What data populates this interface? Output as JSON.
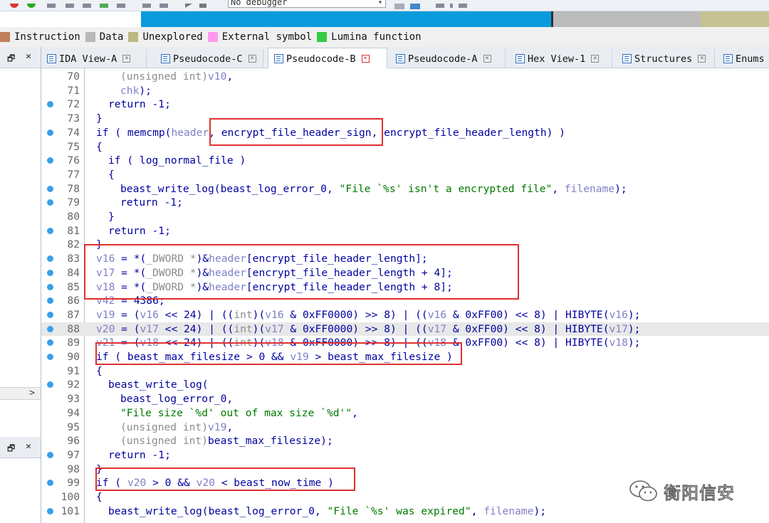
{
  "toolbar": {
    "debugger_select": "No debugger"
  },
  "legend": [
    {
      "label": "Instruction",
      "color": "#c0805a"
    },
    {
      "label": "Data",
      "color": "#b8b8b8"
    },
    {
      "label": "Unexplored",
      "color": "#bcb882"
    },
    {
      "label": "External symbol",
      "color": "#ff99ee"
    },
    {
      "label": "Lumina function",
      "color": "#33cc44"
    }
  ],
  "tabs": [
    {
      "label": "IDA View-A",
      "icon": "ida-view-icon",
      "active": false
    },
    {
      "label": "Pseudocode-C",
      "icon": "pseudocode-icon",
      "active": false
    },
    {
      "label": "Pseudocode-B",
      "icon": "pseudocode-icon",
      "active": true
    },
    {
      "label": "Pseudocode-A",
      "icon": "pseudocode-icon",
      "active": false
    },
    {
      "label": "Hex View-1",
      "icon": "hex-view-icon",
      "active": false
    },
    {
      "label": "Structures",
      "icon": "structures-icon",
      "active": false
    },
    {
      "label": "Enums",
      "icon": "enums-icon",
      "active": false
    }
  ],
  "left_panel": {
    "pin_glyph": "🗗",
    "close_glyph": "✕",
    "scroll_glyph": ">"
  },
  "code_lines": [
    {
      "n": "70",
      "dot": false,
      "hl": false,
      "t": [
        [
          "m",
          "(unsigned int)"
        ],
        [
          "v",
          "v10"
        ],
        [
          "p",
          ",\n"
        ]
      ]
    },
    {
      "n": "71",
      "dot": false,
      "hl": false,
      "t": [
        [
          "v",
          "chk"
        ],
        [
          "p",
          ");"
        ]
      ]
    },
    {
      "n": "72",
      "dot": true,
      "hl": false,
      "t": [
        [
          "p",
          "return -1;"
        ]
      ]
    },
    {
      "n": "73",
      "dot": false,
      "hl": false,
      "t": [
        [
          "p",
          "}"
        ]
      ]
    },
    {
      "n": "74",
      "dot": true,
      "hl": false,
      "t": [
        [
          "p",
          "if ( memcmp("
        ],
        [
          "v",
          "header"
        ],
        [
          "p",
          ", encrypt_file_header_sign, encrypt_file_header_length) )"
        ]
      ]
    },
    {
      "n": "75",
      "dot": false,
      "hl": false,
      "t": [
        [
          "p",
          "{"
        ]
      ]
    },
    {
      "n": "76",
      "dot": true,
      "hl": false,
      "t": [
        [
          "p",
          "if ( log_normal_file )"
        ]
      ]
    },
    {
      "n": "77",
      "dot": false,
      "hl": false,
      "t": [
        [
          "p",
          "{"
        ]
      ]
    },
    {
      "n": "78",
      "dot": true,
      "hl": false,
      "t": [
        [
          "p",
          "beast_write_log(beast_log_error_0, "
        ],
        [
          "s",
          "\"File `%s' isn't a encrypted file\""
        ],
        [
          "p",
          ", "
        ],
        [
          "v",
          "filename"
        ],
        [
          "p",
          ");"
        ]
      ]
    },
    {
      "n": "79",
      "dot": true,
      "hl": false,
      "t": [
        [
          "p",
          "return -1;"
        ]
      ]
    },
    {
      "n": "80",
      "dot": false,
      "hl": false,
      "t": [
        [
          "p",
          "}"
        ]
      ]
    },
    {
      "n": "81",
      "dot": true,
      "hl": false,
      "t": [
        [
          "p",
          "return -1;"
        ]
      ]
    },
    {
      "n": "82",
      "dot": false,
      "hl": false,
      "t": [
        [
          "p",
          "}"
        ]
      ]
    },
    {
      "n": "83",
      "dot": true,
      "hl": false,
      "t": [
        [
          "v",
          "v16"
        ],
        [
          "p",
          " = *("
        ],
        [
          "m",
          "_DWORD *"
        ],
        [
          "p",
          ")&"
        ],
        [
          "v",
          "header"
        ],
        [
          "p",
          "[encrypt_file_header_length];"
        ]
      ]
    },
    {
      "n": "84",
      "dot": true,
      "hl": false,
      "t": [
        [
          "v",
          "v17"
        ],
        [
          "p",
          " = *("
        ],
        [
          "m",
          "_DWORD *"
        ],
        [
          "p",
          ")&"
        ],
        [
          "v",
          "header"
        ],
        [
          "p",
          "[encrypt_file_header_length + 4];"
        ]
      ]
    },
    {
      "n": "85",
      "dot": true,
      "hl": false,
      "t": [
        [
          "v",
          "v18"
        ],
        [
          "p",
          " = *("
        ],
        [
          "m",
          "_DWORD *"
        ],
        [
          "p",
          ")&"
        ],
        [
          "v",
          "header"
        ],
        [
          "p",
          "[encrypt_file_header_length + 8];"
        ]
      ]
    },
    {
      "n": "86",
      "dot": true,
      "hl": false,
      "t": [
        [
          "v",
          "v42"
        ],
        [
          "p",
          " = 4386;"
        ]
      ]
    },
    {
      "n": "87",
      "dot": true,
      "hl": false,
      "t": [
        [
          "v",
          "v19"
        ],
        [
          "p",
          " = ("
        ],
        [
          "v",
          "v16"
        ],
        [
          "p",
          " << 24) | (("
        ],
        [
          "m",
          "int"
        ],
        [
          "p",
          ")("
        ],
        [
          "v",
          "v16"
        ],
        [
          "p",
          " & 0xFF0000) >> 8) | (("
        ],
        [
          "v",
          "v16"
        ],
        [
          "p",
          " & 0xFF00) << 8) | HIBYTE("
        ],
        [
          "v",
          "v16"
        ],
        [
          "p",
          ");"
        ]
      ]
    },
    {
      "n": "88",
      "dot": true,
      "hl": true,
      "t": [
        [
          "v",
          "v20"
        ],
        [
          "p",
          " = ("
        ],
        [
          "v",
          "v17"
        ],
        [
          "p",
          " << 24) | (("
        ],
        [
          "m",
          "int"
        ],
        [
          "p",
          ")("
        ],
        [
          "v",
          "v17"
        ],
        [
          "p",
          " & 0xFF0000) >> 8) | (("
        ],
        [
          "v",
          "v17"
        ],
        [
          "p",
          " & 0xFF00) << 8) | HIBYTE("
        ],
        [
          "v",
          "v17"
        ],
        [
          "p",
          ");"
        ]
      ]
    },
    {
      "n": "89",
      "dot": true,
      "hl": false,
      "t": [
        [
          "v",
          "v21"
        ],
        [
          "p",
          " = ("
        ],
        [
          "v",
          "v18"
        ],
        [
          "p",
          " << 24) | (("
        ],
        [
          "m",
          "int"
        ],
        [
          "p",
          ")("
        ],
        [
          "v",
          "v18"
        ],
        [
          "p",
          " & 0xFF0000) >> 8) | (("
        ],
        [
          "v",
          "v18"
        ],
        [
          "p",
          " & 0xFF00) << 8) | HIBYTE("
        ],
        [
          "v",
          "v18"
        ],
        [
          "p",
          ");"
        ]
      ]
    },
    {
      "n": "90",
      "dot": true,
      "hl": false,
      "t": [
        [
          "p",
          "if ( beast_max_filesize > 0 && "
        ],
        [
          "v",
          "v19"
        ],
        [
          "p",
          " > beast_max_filesize )"
        ]
      ]
    },
    {
      "n": "91",
      "dot": false,
      "hl": false,
      "t": [
        [
          "p",
          "{"
        ]
      ]
    },
    {
      "n": "92",
      "dot": true,
      "hl": false,
      "t": [
        [
          "p",
          "beast_write_log("
        ]
      ]
    },
    {
      "n": "93",
      "dot": false,
      "hl": false,
      "t": [
        [
          "p",
          "beast_log_error_0,"
        ]
      ]
    },
    {
      "n": "94",
      "dot": false,
      "hl": false,
      "t": [
        [
          "s",
          "\"File size `%d' out of max size `%d'\""
        ],
        [
          "p",
          ","
        ]
      ]
    },
    {
      "n": "95",
      "dot": false,
      "hl": false,
      "t": [
        [
          "m",
          "(unsigned int)"
        ],
        [
          "v",
          "v19"
        ],
        [
          "p",
          ","
        ]
      ]
    },
    {
      "n": "96",
      "dot": false,
      "hl": false,
      "t": [
        [
          "m",
          "(unsigned int)"
        ],
        [
          "p",
          "beast_max_filesize);"
        ]
      ]
    },
    {
      "n": "97",
      "dot": true,
      "hl": false,
      "t": [
        [
          "p",
          "return -1;"
        ]
      ]
    },
    {
      "n": "98",
      "dot": false,
      "hl": false,
      "t": [
        [
          "p",
          "}"
        ]
      ]
    },
    {
      "n": "99",
      "dot": true,
      "hl": false,
      "t": [
        [
          "p",
          "if ( "
        ],
        [
          "v",
          "v20"
        ],
        [
          "p",
          " > 0 && "
        ],
        [
          "v",
          "v20"
        ],
        [
          "p",
          " < beast_now_time )"
        ]
      ]
    },
    {
      "n": "100",
      "dot": false,
      "hl": false,
      "t": [
        [
          "p",
          "{"
        ]
      ]
    },
    {
      "n": "101",
      "dot": true,
      "hl": false,
      "t": [
        [
          "p",
          "beast_write_log(beast_log_error_0, "
        ],
        [
          "s",
          "\"File `%s' was expired\""
        ],
        [
          "p",
          ", "
        ],
        [
          "v",
          "filename"
        ],
        [
          "p",
          ");"
        ]
      ]
    }
  ],
  "watermark": {
    "text": "衡阳信安"
  }
}
